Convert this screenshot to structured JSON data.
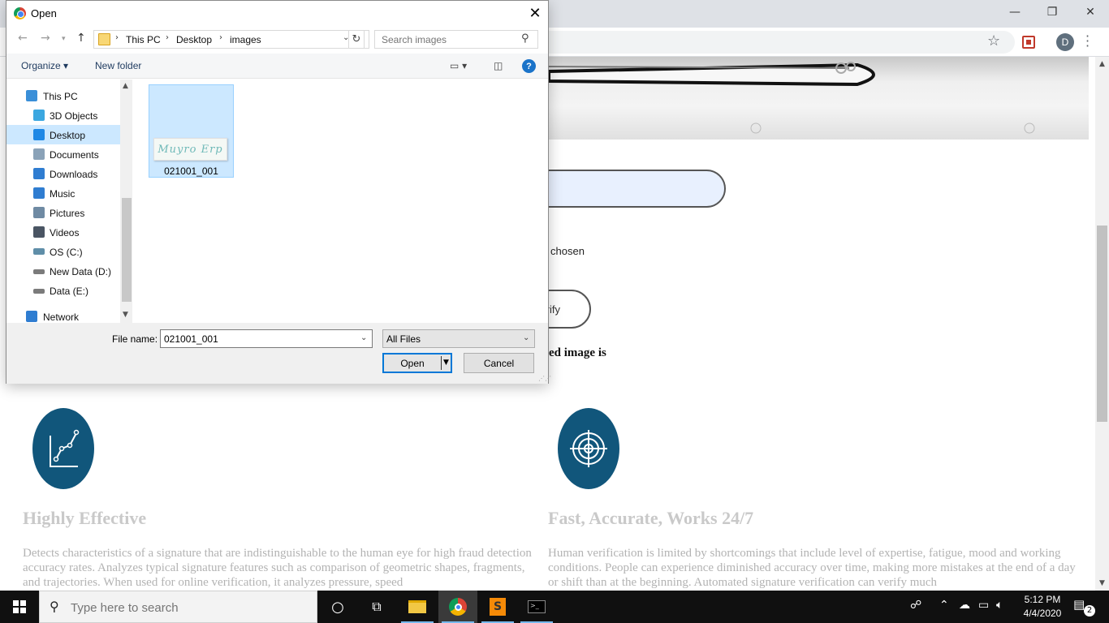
{
  "dialog": {
    "title": "Open",
    "breadcrumb": [
      "This PC",
      "Desktop",
      "images"
    ],
    "search_placeholder": "Search images",
    "toolbar": {
      "organize": "Organize ▾",
      "new_folder": "New folder",
      "help": "?"
    },
    "nav_items": [
      {
        "label": "This PC",
        "icon": "computer-icon",
        "color": "#3a8fd8",
        "selected": false
      },
      {
        "label": "3D Objects",
        "icon": "cube-icon",
        "color": "#3ba7e0",
        "selected": false
      },
      {
        "label": "Desktop",
        "icon": "desktop-icon",
        "color": "#1e88e5",
        "selected": true
      },
      {
        "label": "Documents",
        "icon": "document-icon",
        "color": "#8aa2b8",
        "selected": false
      },
      {
        "label": "Downloads",
        "icon": "download-icon",
        "color": "#2f7dd1",
        "selected": false
      },
      {
        "label": "Music",
        "icon": "music-icon",
        "color": "#2f7dd1",
        "selected": false
      },
      {
        "label": "Pictures",
        "icon": "pictures-icon",
        "color": "#6f8aa3",
        "selected": false
      },
      {
        "label": "Videos",
        "icon": "video-icon",
        "color": "#4a5563",
        "selected": false
      },
      {
        "label": "OS (C:)",
        "icon": "drive-icon",
        "color": "#5f8ea8",
        "selected": false
      },
      {
        "label": "New Data (D:)",
        "icon": "drive-icon",
        "color": "#7b7b7b",
        "selected": false
      },
      {
        "label": "Data (E:)",
        "icon": "drive-icon",
        "color": "#7b7b7b",
        "selected": false
      },
      {
        "label": "Network",
        "icon": "network-icon",
        "color": "#2f7dd1",
        "selected": false
      }
    ],
    "file": {
      "name": "021001_001",
      "thumb_text": "Muyro Erp"
    },
    "file_name_label": "File name:",
    "file_name_value": "021001_001",
    "file_type": "All Files",
    "open_label": "Open",
    "cancel_label": "Cancel"
  },
  "page": {
    "chosen_text": "chosen",
    "verify_label": "rify",
    "result_text": "ed image is",
    "features": [
      {
        "title": "Highly Effective",
        "icon": "chart-line-icon",
        "desc": "Detects characteristics of a signature that are indistinguishable to the human eye for high fraud detection accuracy rates. Analyzes typical signature features such as comparison of geometric shapes, fragments, and trajectories. When used for online verification, it analyzes pressure, speed"
      },
      {
        "title": "Fast, Accurate, Works 24/7",
        "icon": "target-icon",
        "desc": "Human verification is limited by shortcomings that include level of expertise, fatigue, mood and working conditions. People can experience diminished accuracy over time, making more mistakes at the end of a day or shift than at the beginning. Automated signature verification can verify much"
      }
    ],
    "accent": "#11567b"
  },
  "browser": {
    "avatar_letter": "D"
  },
  "taskbar": {
    "search_placeholder": "Type here to search",
    "time": "5:12 PM",
    "date": "4/4/2020",
    "notification_count": "2"
  }
}
